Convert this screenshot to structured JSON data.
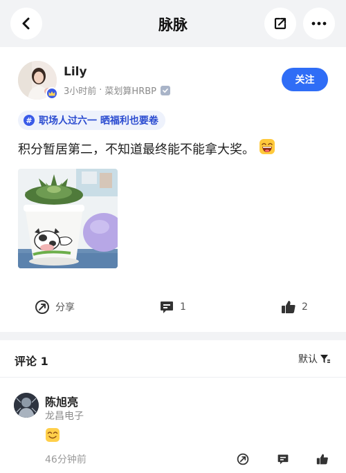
{
  "header": {
    "title": "脉脉",
    "back_icon": "chevron-left-icon",
    "share_icon": "share-external-icon",
    "more_icon": "more-dots-icon"
  },
  "post": {
    "author": {
      "name": "Lily",
      "badge_icon": "crown-icon"
    },
    "time": "3小时前",
    "separator": "·",
    "org": "菜划算HRBP",
    "verify_icon": "verified-badge-icon",
    "follow_label": "关注",
    "topic": {
      "hash": "#",
      "label": "职场人过六一 晒福利也要卷"
    },
    "text": "积分暂居第二，不知道最终能不能拿大奖。",
    "text_emoji": "grinning-face-icon",
    "image": "succulent-cow-pot-photo"
  },
  "actions": {
    "share_label": "分享",
    "comment_count": "1",
    "like_count": "2"
  },
  "comments": {
    "title": "评论 1",
    "sort_label": "默认",
    "items": [
      {
        "name": "陈旭亮",
        "company": "龙昌电子",
        "emoji": "smiling-face-icon",
        "time": "46分钟前"
      }
    ]
  },
  "colors": {
    "accent": "#2f6df6",
    "topic_bg": "#eef2fc",
    "topic_text": "#2a4bd0",
    "band": "#f2f3f5"
  }
}
